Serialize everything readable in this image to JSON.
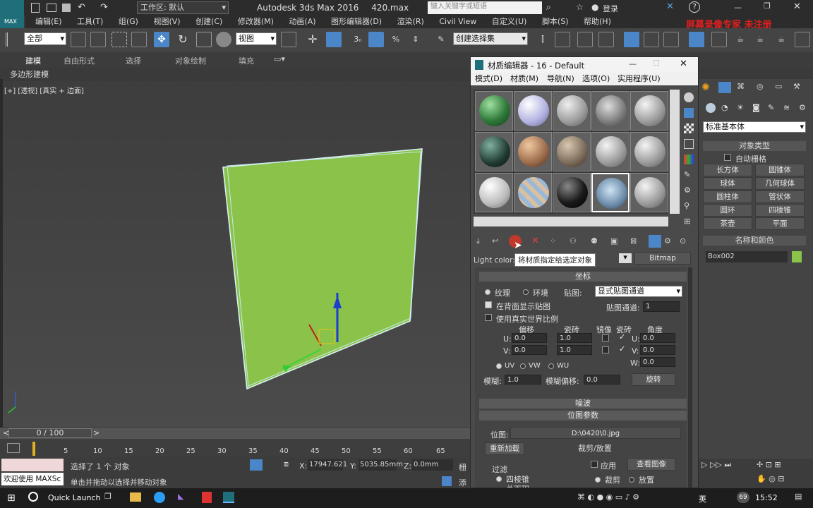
{
  "title": {
    "app": "Autodesk 3ds Max 2016",
    "file": "420.max",
    "workspace": "工作区: 默认",
    "search_placeholder": "键入关键字或短语",
    "login": "登录",
    "logo_text": "MAX"
  },
  "menu": [
    "编辑(E)",
    "工具(T)",
    "组(G)",
    "视图(V)",
    "创建(C)",
    "修改器(M)",
    "动画(A)",
    "图形编辑器(D)",
    "渲染(R)",
    "Civil View",
    "自定义(U)",
    "脚本(S)",
    "帮助(H)"
  ],
  "watermark": "屏幕录像专家 未注册",
  "toolbar": {
    "filter": "全部",
    "refcoord": "视图",
    "selset": "创建选择集"
  },
  "ribbon": {
    "tabs": [
      "建模",
      "自由形式",
      "选择",
      "对象绘制",
      "填充"
    ],
    "sub": "多边形建模"
  },
  "viewport": {
    "label": "[+] [透视] [真实 + 边面]"
  },
  "timeline": {
    "frame": "0 / 100",
    "ticks": [
      "0",
      "5",
      "10",
      "15",
      "20",
      "25",
      "30",
      "35",
      "40",
      "45",
      "50",
      "55",
      "60",
      "65"
    ]
  },
  "status": {
    "welcome": "欢迎使用 MAXSc",
    "selected": "选择了 1 个 对象",
    "hint": "单击并拖动以选择并移动对象",
    "x_label": "X:",
    "x": "17947.621",
    "y_label": "Y:",
    "y": "5035.85mm",
    "z_label": "Z:",
    "z": "0.0mm",
    "grid": "栅",
    "add": "添"
  },
  "matedit": {
    "title": "材质编辑器 - 16 - Default",
    "menu": [
      "模式(D)",
      "材质(M)",
      "导航(N)",
      "选项(O)",
      "实用程序(U)"
    ],
    "tooltip": "将材质指定给选定对象",
    "light_color": "Light color:",
    "bitmap_btn": "Bitmap",
    "coords": {
      "title": "坐标",
      "texture": "纹理",
      "env": "环境",
      "map_label": "贴图:",
      "map_value": "显式贴图通道",
      "show_back": "在背面显示贴图",
      "channel_label": "贴图通道:",
      "channel": "1",
      "realworld": "使用真实世界比例",
      "offset": "偏移",
      "tiling": "瓷砖",
      "mirror": "镜像",
      "tiling2": "瓷砖",
      "angle": "角度",
      "u": "U:",
      "v": "V:",
      "w": "W:",
      "u_off": "0.0",
      "v_off": "0.0",
      "u_tile": "1.0",
      "v_tile": "1.0",
      "u_ang": "0.0",
      "v_ang": "0.0",
      "w_ang": "0.0",
      "uv": "UV",
      "vw": "VW",
      "wu": "WU",
      "blur_label": "模糊:",
      "blur": "1.0",
      "blur_off_label": "模糊偏移:",
      "blur_off": "0.0",
      "rotate": "旋转"
    },
    "noise": "噪波",
    "bitmap_params": {
      "title": "位图参数",
      "bitmap_label": "位图:",
      "path": "D:\\0420\\0.jpg",
      "reload": "重新加载",
      "crop_title": "裁剪/放置",
      "apply": "应用",
      "view_image": "查看图像",
      "filter_title": "过滤",
      "pyramidal": "四棱锥",
      "sat": "总面积",
      "crop": "裁剪",
      "place": "放置"
    }
  },
  "cmdpanel": {
    "dropdown": "标准基本体",
    "object_type": "对象类型",
    "autogrid": "自动栅格",
    "buttons": [
      "长方体",
      "圆锥体",
      "球体",
      "几何球体",
      "圆柱体",
      "管状体",
      "圆环",
      "四棱锥",
      "茶壶",
      "平面"
    ],
    "name_color": "名称和颜色",
    "name": "Box002",
    "obj_color": "#8bc34a"
  },
  "taskbar": {
    "quick": "Quick Launch",
    "lang": "英",
    "clock": "15:52",
    "badge": "69"
  }
}
